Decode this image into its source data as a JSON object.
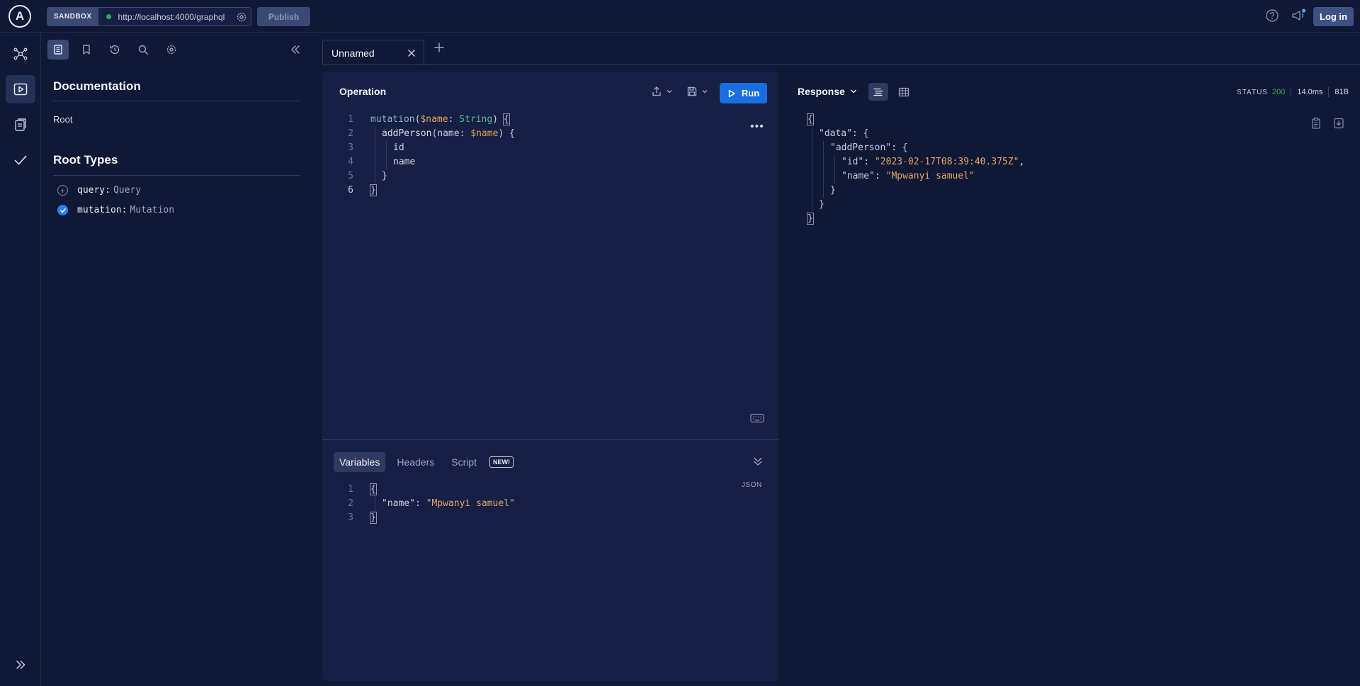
{
  "header": {
    "logo": "A",
    "sandbox_label": "SANDBOX",
    "endpoint_url": "http://localhost:4000/graphql",
    "publish_label": "Publish",
    "login_label": "Log in"
  },
  "docs": {
    "title": "Documentation",
    "root_label": "Root",
    "root_types_title": "Root Types",
    "root_types": [
      {
        "field": "query:",
        "type": "Query",
        "selected": false
      },
      {
        "field": "mutation:",
        "type": "Mutation",
        "selected": true
      }
    ]
  },
  "tabs": [
    {
      "label": "Unnamed",
      "active": true
    }
  ],
  "operation": {
    "title": "Operation",
    "run_label": "Run",
    "line_numbers": [
      "1",
      "2",
      "3",
      "4",
      "5",
      "6"
    ],
    "code": {
      "l1_kw": "mutation",
      "l1_paren_open": "(",
      "l1_var": "$name",
      "l1_colon": ": ",
      "l1_type": "String",
      "l1_close": ") ",
      "l1_brace": "{",
      "l2_fn": "addPerson",
      "l2_open": "(name: ",
      "l2_var": "$name",
      "l2_close": ") {",
      "l3": "id",
      "l4": "name",
      "l5": "}",
      "l6": "}"
    }
  },
  "variables": {
    "tabs": [
      "Variables",
      "Headers",
      "Script"
    ],
    "new_badge": "NEW!",
    "format_label": "JSON",
    "line_numbers": [
      "1",
      "2",
      "3"
    ],
    "l1": "{",
    "l2_key": "\"name\"",
    "l2_colon": ": ",
    "l2_value": "\"Mpwanyi samuel\"",
    "l3": "}"
  },
  "response": {
    "title": "Response",
    "status_label": "STATUS",
    "status_code": "200",
    "time": "14.0ms",
    "size": "81B",
    "lines": {
      "l1": "{",
      "l2_key": "\"data\"",
      "l2_rest": ": {",
      "l3_key": "\"addPerson\"",
      "l3_rest": ": {",
      "l4_key": "\"id\"",
      "l4_colon": ": ",
      "l4_value": "\"2023-02-17T08:39:40.375Z\"",
      "l4_comma": ",",
      "l5_key": "\"name\"",
      "l5_colon": ": ",
      "l5_value": "\"Mpwanyi samuel\"",
      "l6": "}",
      "l7": "}",
      "l8": "}"
    }
  },
  "colors": {
    "background": "#0f1834",
    "panel": "#152044",
    "accent": "#1a6fe0",
    "status_ok": "#21b05b"
  }
}
